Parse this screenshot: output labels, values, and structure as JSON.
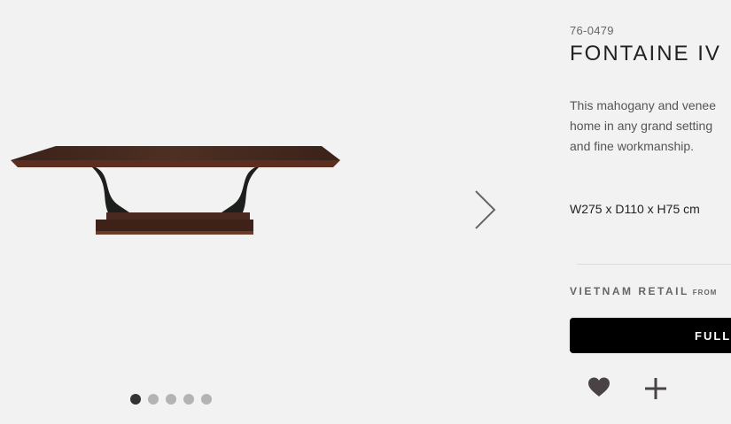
{
  "product": {
    "sku": "76-0479",
    "title": "FONTAINE IV",
    "description_lines": [
      "This mahogany and venee",
      "home in any grand setting",
      "and fine workmanship."
    ],
    "dimensions": "W275 x D110 x H75 cm"
  },
  "pricing": {
    "label": "VIETNAM RETAIL",
    "from": "FROM"
  },
  "cta": {
    "label": "FULL"
  },
  "gallery": {
    "slide_count": 5,
    "active_slide": 1
  },
  "icons": {
    "next": "chevron-right-icon",
    "favorite": "heart-icon",
    "add": "plus-icon"
  },
  "colors": {
    "background": "#f2f2f2",
    "cta_background": "#000000",
    "icon_color": "#4a4346",
    "dot_active": "#333333",
    "dot_inactive": "#b3b3b3"
  }
}
